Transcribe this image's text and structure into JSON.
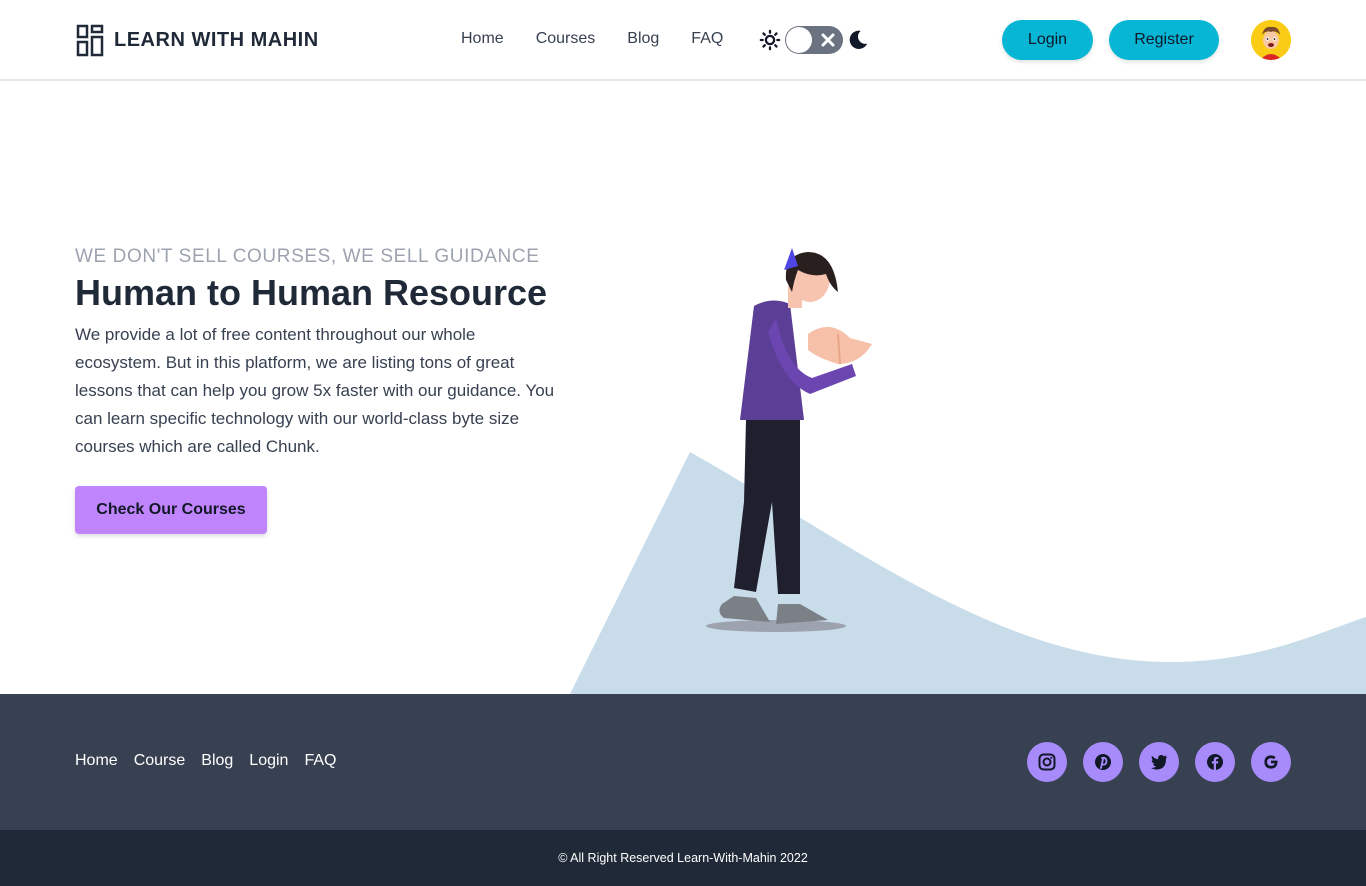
{
  "header": {
    "brand": "LEARN WITH MAHIN",
    "nav": [
      "Home",
      "Courses",
      "Blog",
      "FAQ"
    ],
    "login_label": "Login",
    "register_label": "Register",
    "theme_toggle_state": "light"
  },
  "hero": {
    "tagline": "WE DON'T SELL COURSES, WE SELL GUIDANCE",
    "title": "Human to Human Resource",
    "description": "We provide a lot of free content throughout our whole ecosystem. But in this platform, we are listing tons of great lessons that can help you grow 5x faster with our guidance. You can learn specific technology with our world-class byte size courses which are called Chunk.",
    "cta_label": "Check Our Courses"
  },
  "footer": {
    "nav": [
      "Home",
      "Course",
      "Blog",
      "Login",
      "FAQ"
    ],
    "socials": [
      "instagram-icon",
      "pinterest-icon",
      "twitter-icon",
      "facebook-icon",
      "google-icon"
    ],
    "copyright": "© All Right Reserved Learn-With-Mahin 2022"
  },
  "colors": {
    "accent_cyan": "#06b6d4",
    "accent_purple": "#c084fc",
    "social_purple": "#a78bfa",
    "footer_bg": "#374151",
    "bottom_bar_bg": "#1f2937",
    "hill": "#c9dcea"
  }
}
